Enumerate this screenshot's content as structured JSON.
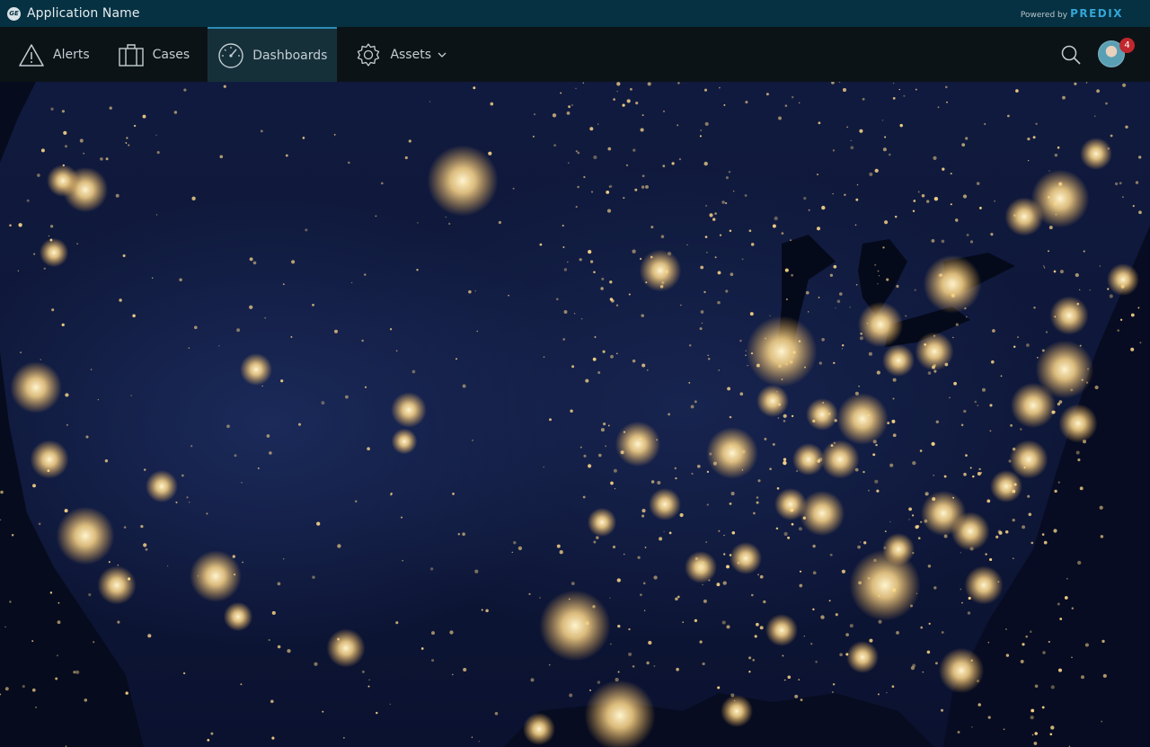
{
  "brand": {
    "logo_text": "GE",
    "app_name": "Application Name",
    "powered_by": "Powered by",
    "platform": "PREDIX"
  },
  "nav": {
    "items": [
      {
        "label": "Alerts",
        "icon": "alert-triangle-icon"
      },
      {
        "label": "Cases",
        "icon": "briefcase-icon"
      },
      {
        "label": "Dashboards",
        "icon": "gauge-icon",
        "active": true
      },
      {
        "label": "Assets",
        "icon": "gear-icon",
        "has_dropdown": true
      }
    ],
    "notification_count": "4"
  },
  "colors": {
    "brand_bar": "#063142",
    "nav_bg": "#0c1317",
    "nav_active": "#16303a",
    "accent": "#2d8db6",
    "badge": "#c1272d",
    "city_light": "#ffd98a"
  },
  "map": {
    "description_icon": "us-night-lights-map"
  }
}
